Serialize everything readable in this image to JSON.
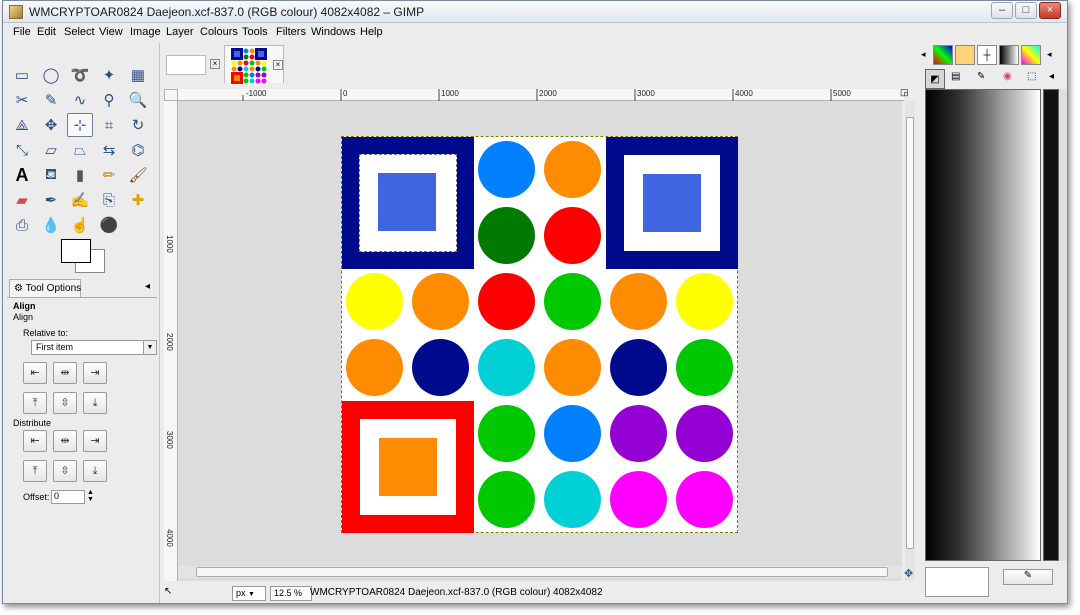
{
  "window": {
    "title": "WMCRYPTOAR0824 Daejeon.xcf-837.0 (RGB colour) 4082x4082 – GIMP",
    "minimize_label": "–",
    "maximize_label": "□",
    "close_label": "×"
  },
  "menubar": {
    "items": [
      "File",
      "Edit",
      "Select",
      "View",
      "Image",
      "Layer",
      "Colours",
      "Tools",
      "Filters",
      "Windows",
      "Help"
    ]
  },
  "tool_options": {
    "tab_label": "Tool Options",
    "heading": "Align",
    "subheading": "Align",
    "relative_to_label": "Relative to:",
    "relative_to_value": "First item",
    "distribute_label": "Distribute",
    "offset_label": "Offset:",
    "offset_value": "0"
  },
  "rulers": {
    "horizontal": [
      "-1000",
      "0",
      "1000",
      "2000",
      "3000",
      "4000",
      "5000"
    ],
    "vertical": [
      "1000",
      "2000",
      "3000",
      "4000"
    ]
  },
  "statusbar": {
    "unit": "px",
    "zoom": "12.5 %",
    "text": "WMCRYPTOAR0824 Daejeon.xcf-837.0 (RGB colour) 4082x4082"
  },
  "colors": {
    "navy": "#000a8c",
    "royal_blue": "#3f65e0",
    "red": "#ff0000",
    "orange": "#ff8c00",
    "green": "#00c800",
    "dark_green": "#007a00",
    "blue": "#0080ff",
    "yellow": "#ffff00",
    "cyan": "#00cfd6",
    "purple": "#9400d3",
    "magenta": "#ff00ff"
  },
  "icons": {
    "close_tab": "×",
    "tab_menu": "◂"
  }
}
